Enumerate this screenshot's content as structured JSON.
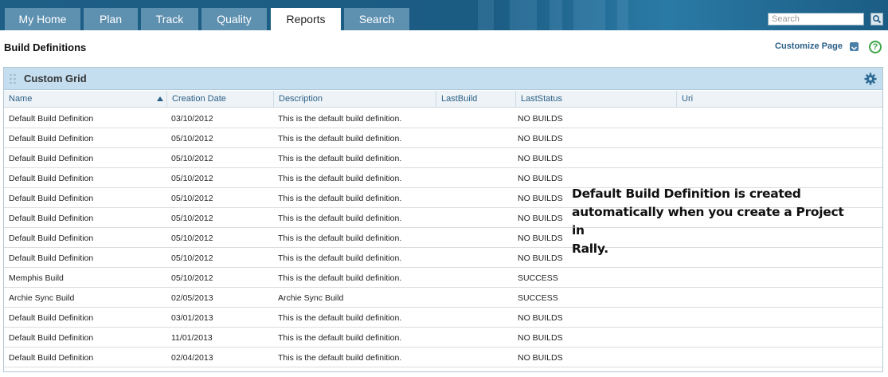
{
  "nav": {
    "tabs": [
      {
        "label": "My Home",
        "active": false
      },
      {
        "label": "Plan",
        "active": false
      },
      {
        "label": "Track",
        "active": false
      },
      {
        "label": "Quality",
        "active": false
      },
      {
        "label": "Reports",
        "active": true
      },
      {
        "label": "Search",
        "active": false
      }
    ],
    "search_placeholder": "Search"
  },
  "header": {
    "title": "Build Definitions",
    "customize_label": "Customize Page",
    "help_label": "?"
  },
  "grid": {
    "title": "Custom Grid",
    "columns": [
      "Name",
      "Creation Date",
      "Description",
      "LastBuild",
      "LastStatus",
      "Uri"
    ],
    "sort_column": "Name",
    "rows": [
      [
        "Default Build Definition",
        "03/10/2012",
        "This is the default build definition.",
        "",
        "NO BUILDS",
        ""
      ],
      [
        "Default Build Definition",
        "05/10/2012",
        "This is the default build definition.",
        "",
        "NO BUILDS",
        ""
      ],
      [
        "Default Build Definition",
        "05/10/2012",
        "This is the default build definition.",
        "",
        "NO BUILDS",
        ""
      ],
      [
        "Default Build Definition",
        "05/10/2012",
        "This is the default build definition.",
        "",
        "NO BUILDS",
        ""
      ],
      [
        "Default Build Definition",
        "05/10/2012",
        "This is the default build definition.",
        "",
        "NO BUILDS",
        ""
      ],
      [
        "Default Build Definition",
        "05/10/2012",
        "This is the default build definition.",
        "",
        "NO BUILDS",
        ""
      ],
      [
        "Default Build Definition",
        "05/10/2012",
        "This is the default build definition.",
        "",
        "NO BUILDS",
        ""
      ],
      [
        "Default Build Definition",
        "05/10/2012",
        "This is the default build definition.",
        "",
        "NO BUILDS",
        ""
      ],
      [
        "Memphis Build",
        "05/10/2012",
        "This is the default build definition.",
        "",
        "SUCCESS",
        ""
      ],
      [
        "Archie Sync Build",
        "02/05/2013",
        "Archie Sync Build",
        "",
        "SUCCESS",
        ""
      ],
      [
        "Default Build Definition",
        "03/01/2013",
        "This is the default build definition.",
        "",
        "NO BUILDS",
        ""
      ],
      [
        "Default Build Definition",
        "11/01/2013",
        "This is the default build definition.",
        "",
        "NO BUILDS",
        ""
      ],
      [
        "Default Build Definition",
        "02/04/2013",
        "This is the default build definition.",
        "",
        "NO BUILDS",
        ""
      ]
    ]
  },
  "annotation": {
    "lines": [
      "Default Build Definition is created",
      "automatically when you create a Project in",
      "Rally."
    ]
  },
  "colors": {
    "nav_bar": "#1b5c83",
    "tab": "#5e90b0",
    "panel_header": "#c4def0",
    "link": "#2a5f86",
    "help_green": "#3fa447"
  },
  "icons": {
    "search": "search-icon",
    "customize": "chevron-down-icon",
    "help": "help-icon",
    "grip": "drag-handle-icon",
    "settings": "gear-icon",
    "sort": "sort-ascending-icon"
  }
}
